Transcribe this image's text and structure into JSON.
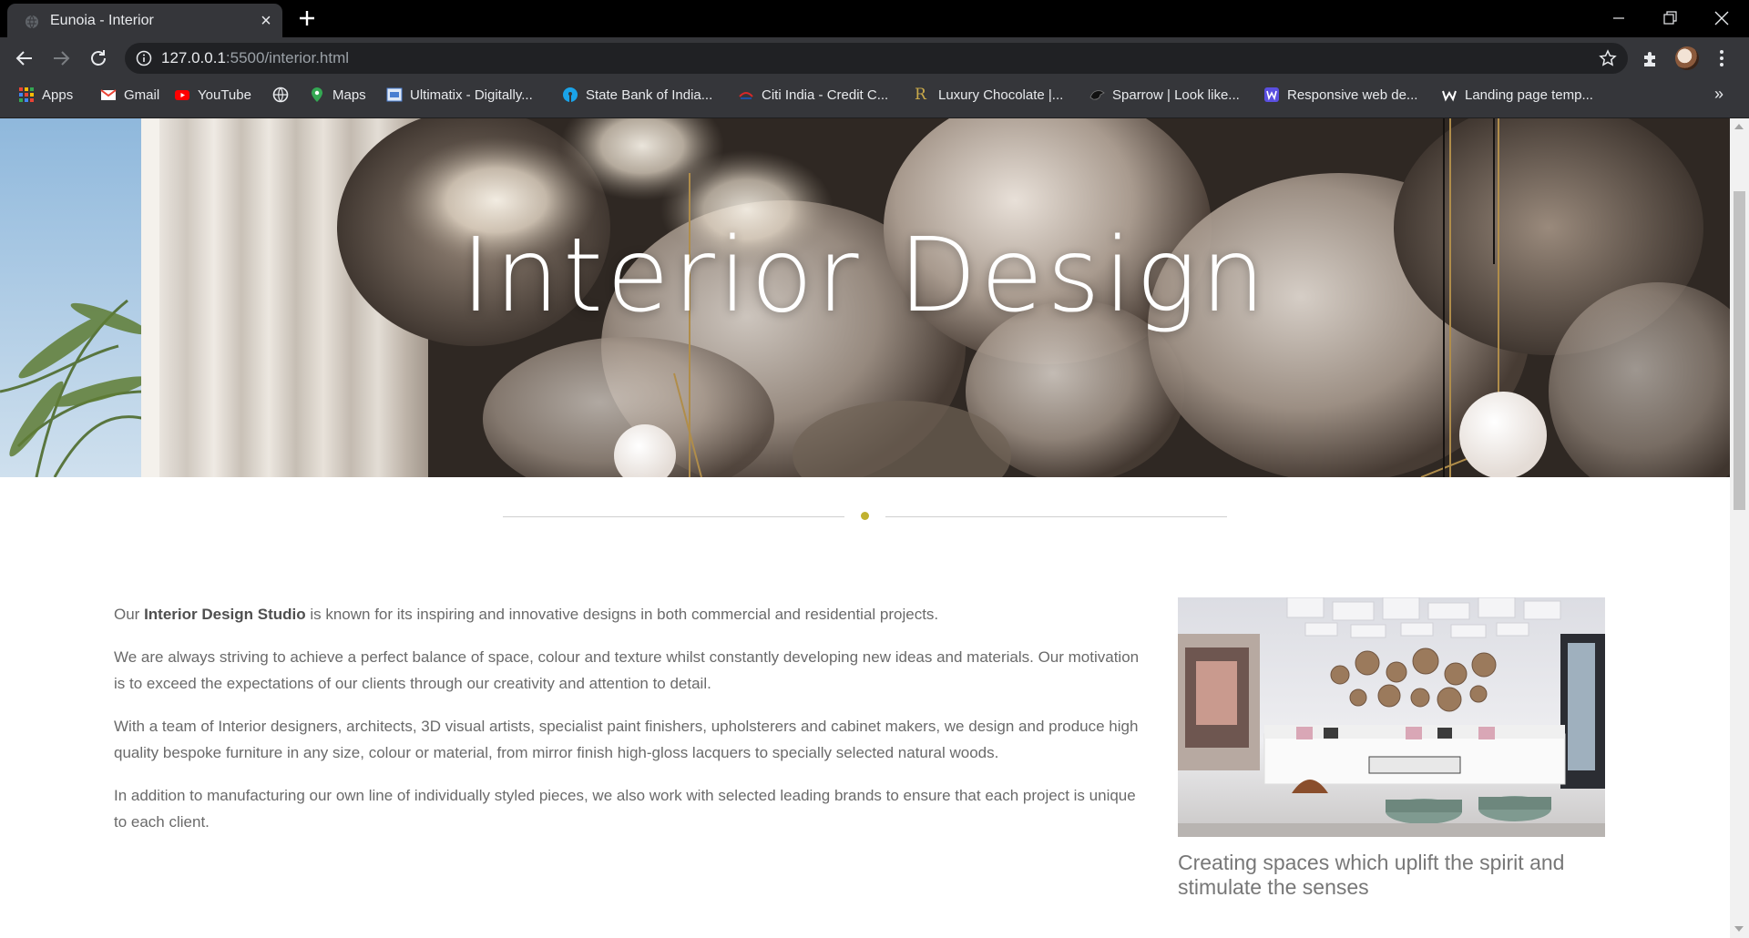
{
  "browser": {
    "tab_title": "Eunoia - Interior",
    "url_host": "127.0.0.1",
    "url_rest": ":5500/interior.html",
    "bookmarks": [
      {
        "label": "Apps",
        "icon": "apps-grid-icon",
        "color": "#ea4335"
      },
      {
        "label": "Gmail",
        "icon": "gmail-icon",
        "color": "#ea4335"
      },
      {
        "label": "YouTube",
        "icon": "youtube-icon",
        "color": "#ff0000"
      },
      {
        "label": "",
        "icon": "globe-icon",
        "color": "#e8eaed"
      },
      {
        "label": "Maps",
        "icon": "maps-icon",
        "color": "#34a853"
      },
      {
        "label": "Ultimatix - Digitally...",
        "icon": "tata-icon",
        "color": "#4a7fd1"
      },
      {
        "label": "State Bank of India...",
        "icon": "sbi-icon",
        "color": "#1aa3e8"
      },
      {
        "label": "Citi India - Credit C...",
        "icon": "citi-icon",
        "color": "#d62828"
      },
      {
        "label": "Luxury Chocolate |...",
        "icon": "royce-icon",
        "color": "#c9a94a"
      },
      {
        "label": "Sparrow | Look like...",
        "icon": "sparrow-icon",
        "color": "#111111"
      },
      {
        "label": "Responsive web de...",
        "icon": "w-blue-icon",
        "color": "#5a4fe0"
      },
      {
        "label": "Landing page temp...",
        "icon": "w-white-icon",
        "color": "#ffffff"
      }
    ],
    "more_bookmarks": "»"
  },
  "hero": {
    "title": "Interior Design"
  },
  "accent_color": "#c1b12f",
  "content": {
    "p1_before": "Our ",
    "p1_bold": "Interior Design Studio",
    "p1_after": " is known for its inspiring and innovative designs in both commercial and residential projects.",
    "p2": "We are always striving to achieve a perfect balance of space, colour and texture whilst constantly developing new ideas and materials. Our motivation is to exceed the expectations of our clients through our creativity and attention to detail.",
    "p3": "With a team of Interior designers, architects, 3D visual artists, specialist paint finishers, upholsterers and cabinet makers, we design and produce high quality bespoke furniture in any size, colour or material, from mirror finish high-gloss lacquers to specially selected natural woods.",
    "p4": "In addition to manufacturing our own line of individually styled pieces, we also work with selected leading brands to ensure that each project is unique to each client."
  },
  "side": {
    "caption": "Creating spaces which uplift the spirit and stimulate the senses"
  }
}
